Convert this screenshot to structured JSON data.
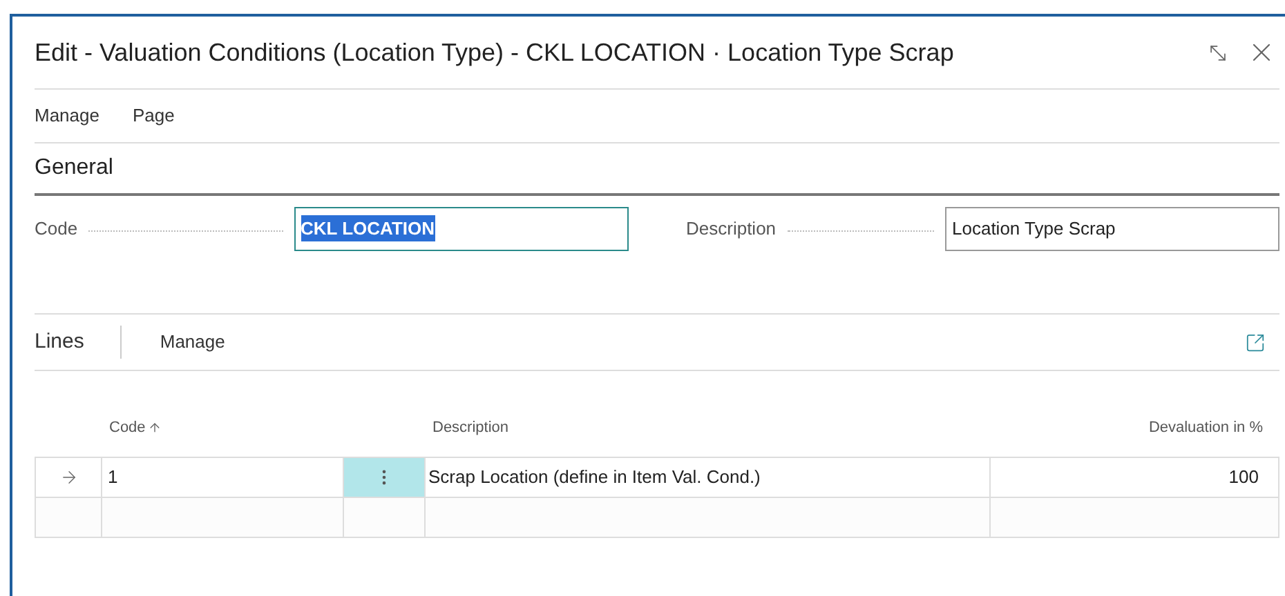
{
  "window": {
    "title": "Edit - Valuation Conditions (Location Type) - CKL LOCATION · Location Type Scrap"
  },
  "menu": [
    "Manage",
    "Page"
  ],
  "general": {
    "heading": "General",
    "fields": [
      {
        "label": "Code",
        "value": "CKL LOCATION",
        "focused": true
      },
      {
        "label": "Description",
        "value": "Location Type Scrap",
        "focused": false
      }
    ]
  },
  "lines": {
    "title": "Lines",
    "actions": [
      "Manage"
    ],
    "columns": [
      {
        "label": "Code",
        "sorted": true
      },
      {
        "label": "Description"
      },
      {
        "label": "Devaluation in %"
      }
    ],
    "rows": [
      {
        "selected": true,
        "cells": [
          "1",
          "Scrap Location (define in Item Val. Cond.)",
          "100"
        ]
      },
      {
        "selected": false,
        "cells": [
          "",
          "",
          ""
        ]
      }
    ]
  }
}
